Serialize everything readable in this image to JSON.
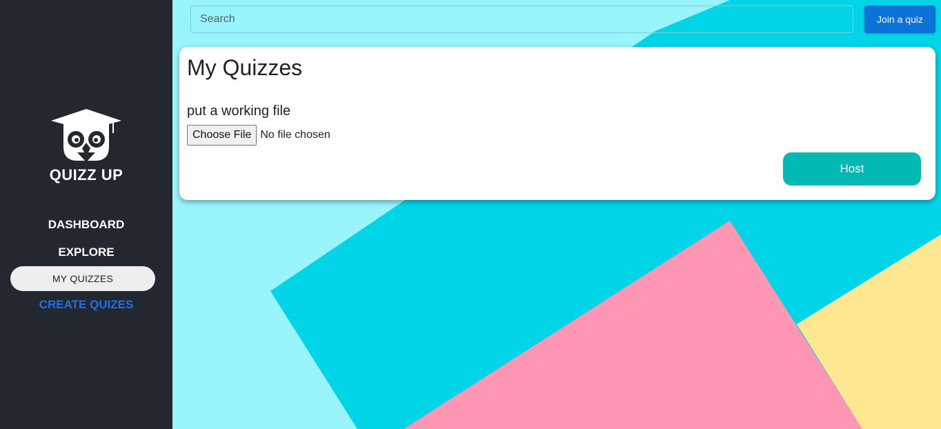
{
  "sidebar": {
    "brand": "QUIZZ UP",
    "items": [
      {
        "label": "DASHBOARD"
      },
      {
        "label": "EXPLORE"
      },
      {
        "label": "MY QUIZZES",
        "active": true
      },
      {
        "label": "CREATE QUIZES"
      }
    ]
  },
  "header": {
    "search_placeholder": "Search",
    "join_label": "Join a quiz"
  },
  "main": {
    "title": "My Quizzes",
    "file_label": "put a working file",
    "file_button": "Choose File",
    "file_status": "No file chosen",
    "host_label": "Host"
  },
  "colors": {
    "sidebar_bg": "#222730",
    "accent_link": "#1d6ff5",
    "join_button": "#0d72d8",
    "host_button": "#00b9b2",
    "bg_light_cyan": "#9af4fb",
    "bg_cyan": "#00d5e8",
    "bg_pink": "#ff97b4",
    "bg_yellow": "#ffe792"
  },
  "icons": {
    "logo": "owl-graduation-cap-icon"
  }
}
